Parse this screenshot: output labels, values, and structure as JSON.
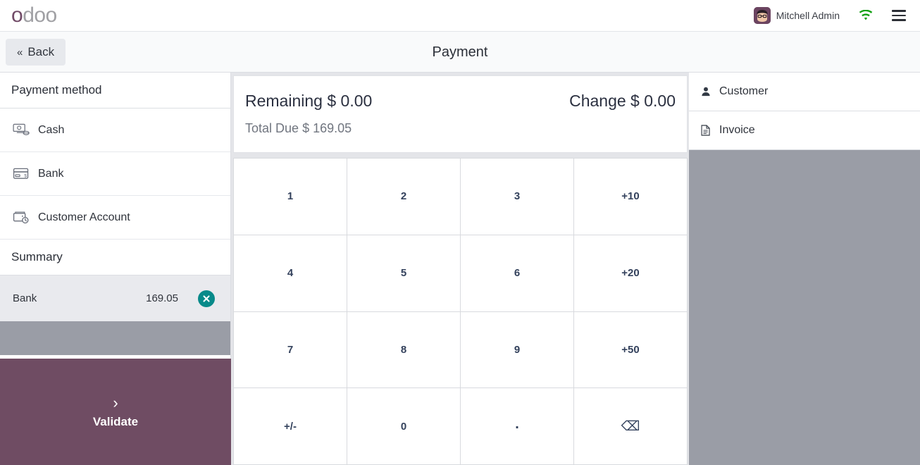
{
  "topbar": {
    "logo_first": "o",
    "logo_rest": "doo",
    "username": "Mitchell Admin",
    "avatar_icon": "user-avatar",
    "wifi_icon": "wifi-icon",
    "menu_icon": "hamburger-menu-icon",
    "wifi_color": "#12a012"
  },
  "subheader": {
    "back_label": "Back",
    "back_chevron": "«",
    "title": "Payment"
  },
  "left": {
    "payment_method_title": "Payment method",
    "methods": [
      {
        "label": "Cash",
        "icon": "cash-icon"
      },
      {
        "label": "Bank",
        "icon": "credit-card-icon"
      },
      {
        "label": "Customer Account",
        "icon": "wallet-clock-icon"
      }
    ],
    "summary_title": "Summary",
    "summary_rows": [
      {
        "name": "Bank",
        "amount": "169.05",
        "delete_icon": "remove-circle-icon"
      }
    ],
    "validate_label": "Validate",
    "validate_chevron": "›",
    "validate_color": "#6f4c63"
  },
  "totals": {
    "remaining_label": "Remaining",
    "remaining_value": "$ 0.00",
    "change_label": "Change",
    "change_value": "$ 0.00",
    "total_due_label": "Total Due",
    "total_due_value": "$ 169.05"
  },
  "numpad": {
    "keys": [
      {
        "label": "1",
        "kind": "digit"
      },
      {
        "label": "2",
        "kind": "digit"
      },
      {
        "label": "3",
        "kind": "digit"
      },
      {
        "label": "+10",
        "kind": "add"
      },
      {
        "label": "4",
        "kind": "digit"
      },
      {
        "label": "5",
        "kind": "digit"
      },
      {
        "label": "6",
        "kind": "digit"
      },
      {
        "label": "+20",
        "kind": "add"
      },
      {
        "label": "7",
        "kind": "digit"
      },
      {
        "label": "8",
        "kind": "digit"
      },
      {
        "label": "9",
        "kind": "digit"
      },
      {
        "label": "+50",
        "kind": "add"
      },
      {
        "label": "+/-",
        "kind": "sign"
      },
      {
        "label": "0",
        "kind": "digit"
      },
      {
        "label": ".",
        "kind": "dot"
      },
      {
        "label": "⌫",
        "kind": "backspace"
      }
    ]
  },
  "right": {
    "rows": [
      {
        "label": "Customer",
        "icon": "user-icon"
      },
      {
        "label": "Invoice",
        "icon": "file-icon"
      }
    ]
  }
}
